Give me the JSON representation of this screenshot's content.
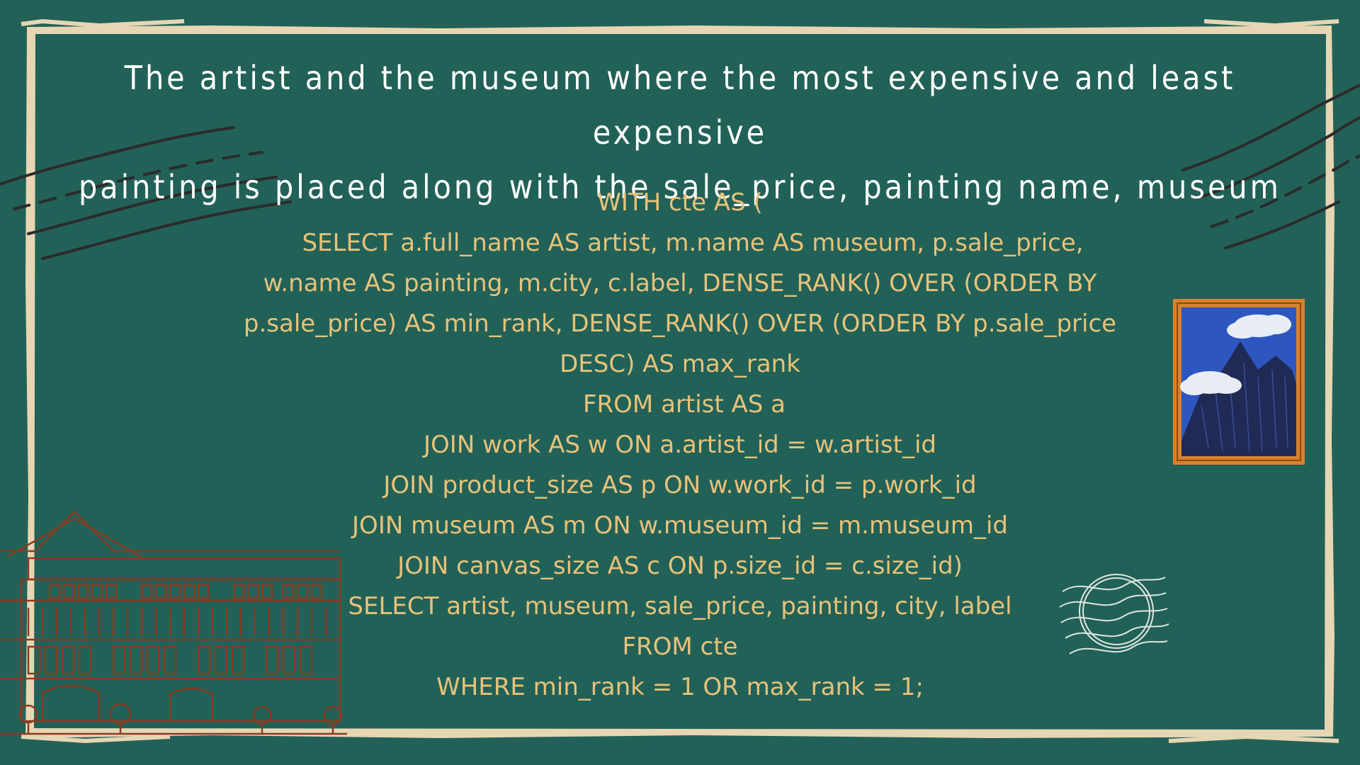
{
  "slide": {
    "title_line1": "The artist and the museum where the most expensive and least expensive",
    "title_line2": "painting is placed along with the sale_price, painting name, museum"
  },
  "code_lines": [
    "WITH cte AS (",
    "SELECT a.full_name AS artist, m.name AS museum, p.sale_price,",
    "w.name AS painting, m.city, c.label, DENSE_RANK() OVER (ORDER BY",
    "p.sale_price) AS min_rank, DENSE_RANK() OVER (ORDER BY p.sale_price",
    "DESC) AS max_rank",
    "FROM artist AS a",
    "JOIN work AS w ON a.artist_id = w.artist_id",
    "JOIN product_size AS p ON w.work_id = p.work_id",
    "JOIN museum AS m ON w.museum_id = m.museum_id",
    "JOIN canvas_size AS c ON p.size_id = c.size_id)",
    "SELECT artist, museum, sale_price, painting, city, label",
    "FROM cte",
    "WHERE min_rank = 1 OR max_rank = 1;"
  ],
  "colors": {
    "background": "#226157",
    "frame": "#e6d6b4",
    "title_text": "#ffffff",
    "code_text": "#e7c27a",
    "building_lines": "#8a3a22",
    "picture_frame": "#d9822b",
    "sky": "#2e56c0",
    "mountain": "#1f2a55"
  },
  "icons": {
    "postmark_left": "wavy-postmark-lines",
    "postmark_right": "wavy-postmark-lines",
    "stamp": "circle-postmark-stamp",
    "building": "museum-building-outline",
    "painting": "framed-mountain-painting"
  }
}
